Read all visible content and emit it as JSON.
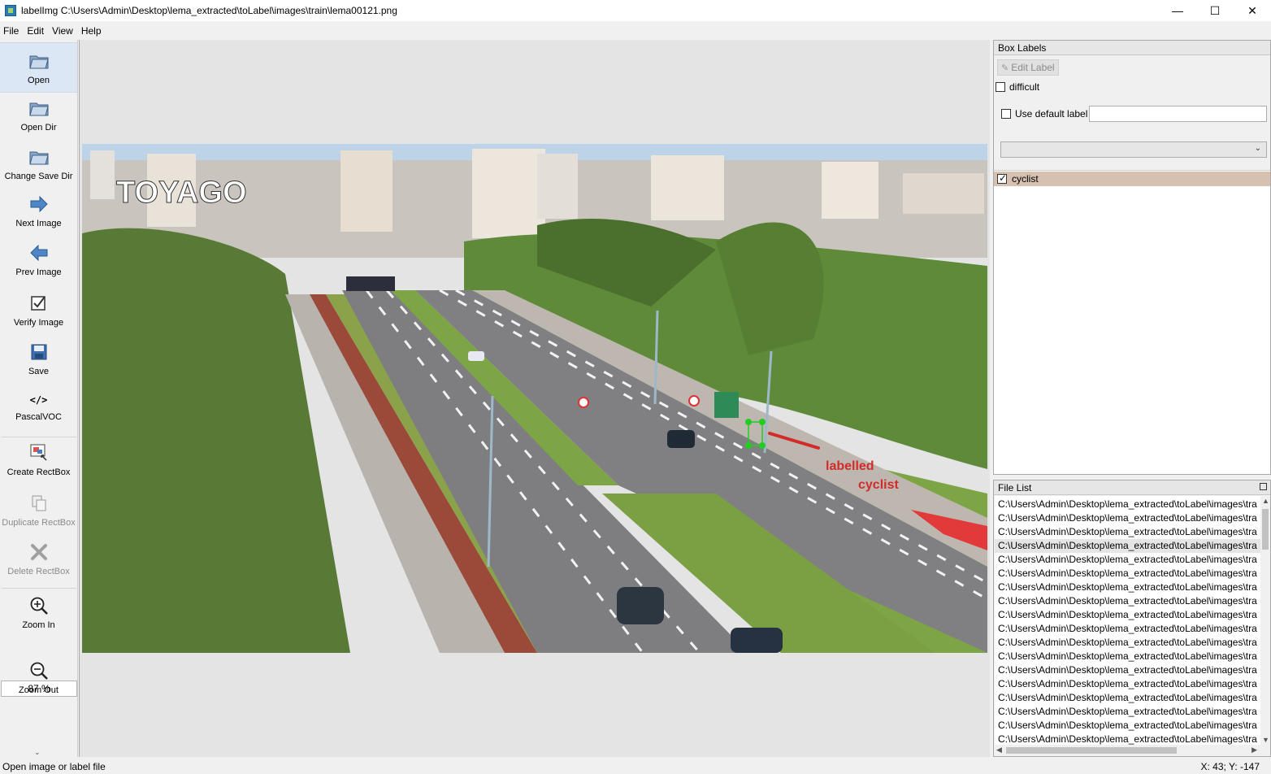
{
  "window": {
    "title": "labelImg C:\\Users\\Admin\\Desktop\\lema_extracted\\toLabel\\images\\train\\lema00121.png",
    "minimize": "—",
    "maximize": "☐",
    "close": "✕"
  },
  "menu": [
    "File",
    "Edit",
    "View",
    "Help"
  ],
  "toolbar": {
    "open": "Open",
    "open_dir": "Open Dir",
    "change_save_dir": "Change Save Dir",
    "next_image": "Next Image",
    "prev_image": "Prev Image",
    "verify_image": "Verify Image",
    "save": "Save",
    "format": "PascalVOC",
    "format_icon": "</>",
    "create_rectbox": "Create RectBox",
    "duplicate_rectbox": "Duplicate RectBox",
    "delete_rectbox": "Delete RectBox",
    "zoom_in": "Zoom In",
    "zoom_value": "87 %",
    "zoom_out": "Zoom Out"
  },
  "canvas": {
    "watermark": "TOYAGO",
    "annotation_line1": "labelled",
    "annotation_line2": "cyclist"
  },
  "box_labels": {
    "title": "Box Labels",
    "edit_label": "Edit Label",
    "difficult": "difficult",
    "use_default_label": "Use default label",
    "default_label_value": "",
    "labels": [
      {
        "name": "cyclist",
        "checked": true
      }
    ]
  },
  "file_list": {
    "title": "File List",
    "selected_index": 3,
    "files": [
      "C:\\Users\\Admin\\Desktop\\lema_extracted\\toLabel\\images\\tra",
      "C:\\Users\\Admin\\Desktop\\lema_extracted\\toLabel\\images\\tra",
      "C:\\Users\\Admin\\Desktop\\lema_extracted\\toLabel\\images\\tra",
      "C:\\Users\\Admin\\Desktop\\lema_extracted\\toLabel\\images\\tra",
      "C:\\Users\\Admin\\Desktop\\lema_extracted\\toLabel\\images\\tra",
      "C:\\Users\\Admin\\Desktop\\lema_extracted\\toLabel\\images\\tra",
      "C:\\Users\\Admin\\Desktop\\lema_extracted\\toLabel\\images\\tra",
      "C:\\Users\\Admin\\Desktop\\lema_extracted\\toLabel\\images\\tra",
      "C:\\Users\\Admin\\Desktop\\lema_extracted\\toLabel\\images\\tra",
      "C:\\Users\\Admin\\Desktop\\lema_extracted\\toLabel\\images\\tra",
      "C:\\Users\\Admin\\Desktop\\lema_extracted\\toLabel\\images\\tra",
      "C:\\Users\\Admin\\Desktop\\lema_extracted\\toLabel\\images\\tra",
      "C:\\Users\\Admin\\Desktop\\lema_extracted\\toLabel\\images\\tra",
      "C:\\Users\\Admin\\Desktop\\lema_extracted\\toLabel\\images\\tra",
      "C:\\Users\\Admin\\Desktop\\lema_extracted\\toLabel\\images\\tra",
      "C:\\Users\\Admin\\Desktop\\lema_extracted\\toLabel\\images\\tra",
      "C:\\Users\\Admin\\Desktop\\lema_extracted\\toLabel\\images\\tra",
      "C:\\Users\\Admin\\Desktop\\lema_extracted\\toLabel\\images\\tra"
    ]
  },
  "status": {
    "message": "Open image or label file",
    "coords": "X: 43; Y: -147"
  },
  "colors": {
    "accent_red": "#d42a2a",
    "bbox_green": "#22cc22",
    "selected_label_bg": "#d6c0b0"
  }
}
